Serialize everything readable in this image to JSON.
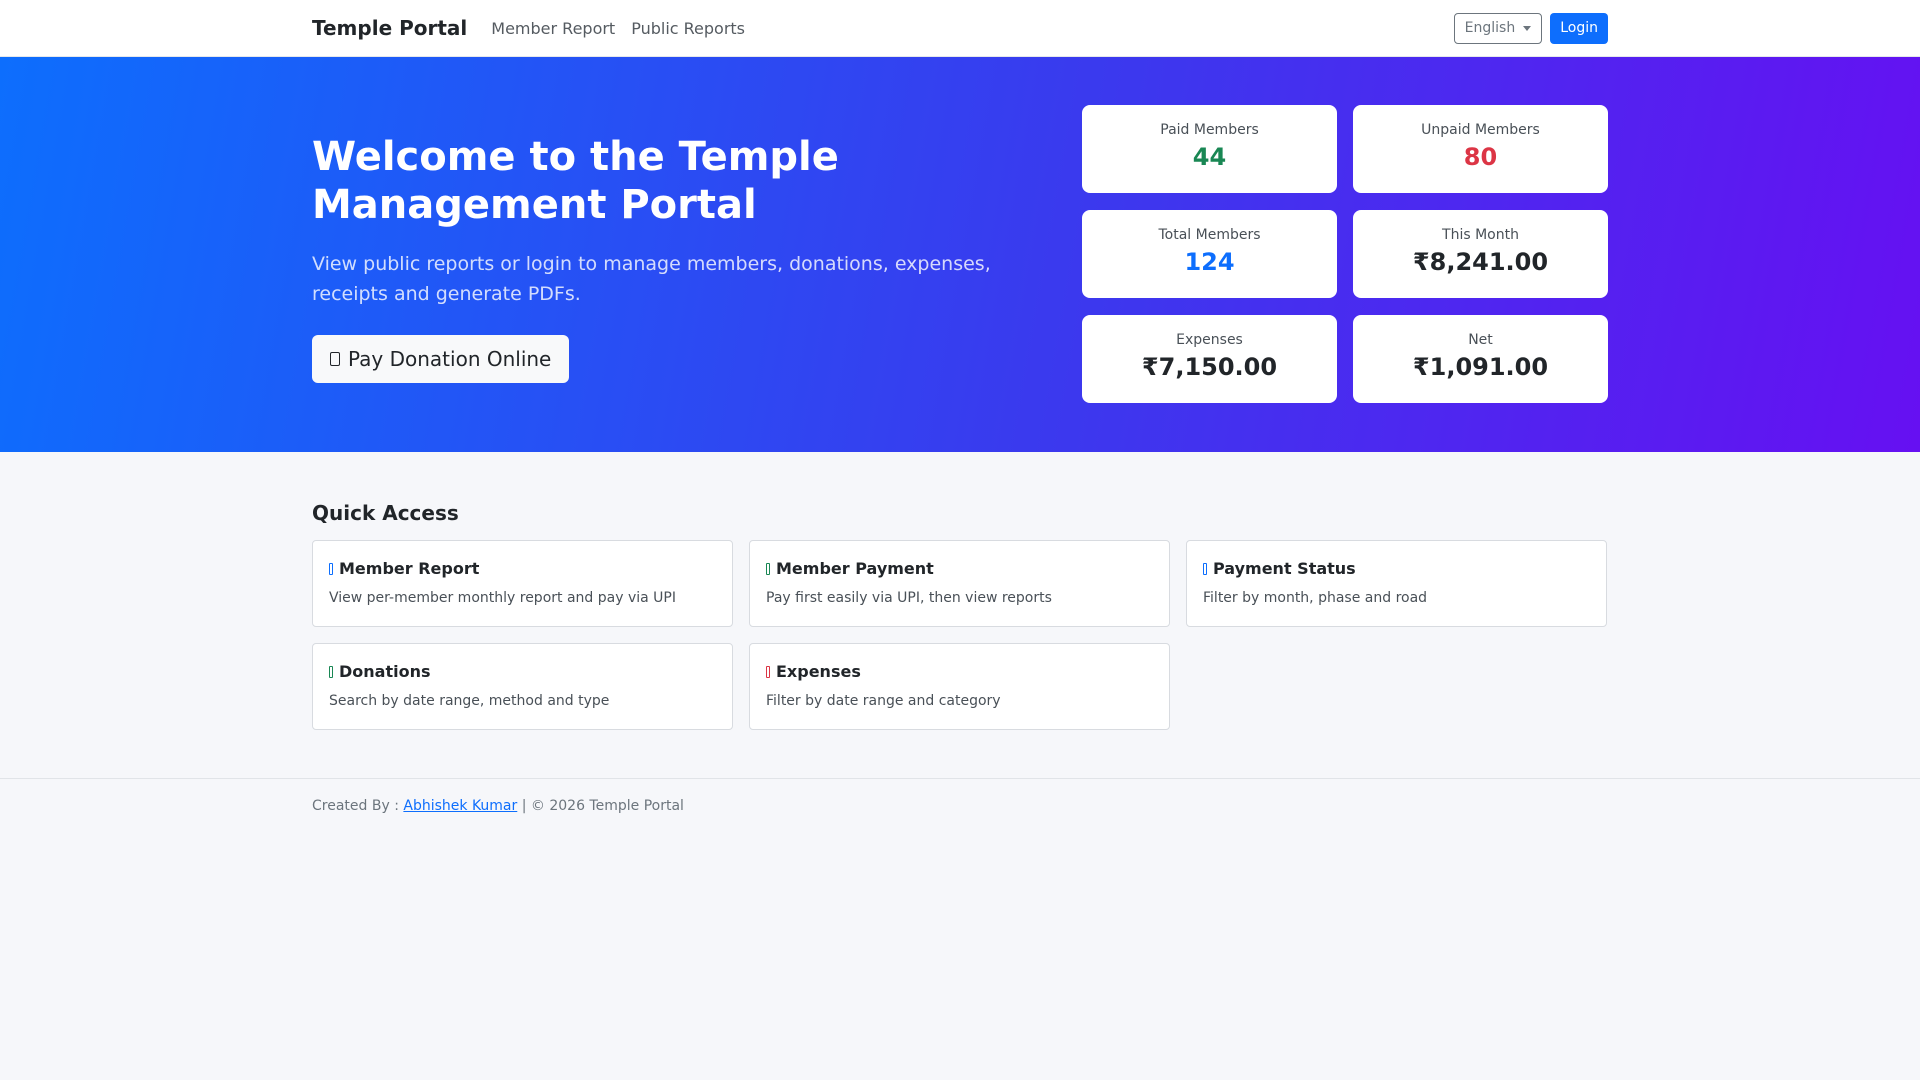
{
  "nav": {
    "brand": "Temple Portal",
    "links": [
      "Member Report",
      "Public Reports"
    ],
    "language": "English",
    "login": "Login"
  },
  "hero": {
    "title": "Welcome to the Temple Management Portal",
    "subtitle": "View public reports or login to manage members, donations, expenses, receipts and generate PDFs.",
    "donate_button": "Pay Donation Online",
    "stats": [
      {
        "label": "Paid Members",
        "value": "44",
        "color": "#198754"
      },
      {
        "label": "Unpaid Members",
        "value": "80",
        "color": "#dc3545"
      },
      {
        "label": "Total Members",
        "value": "124",
        "color": "#0d6efd"
      },
      {
        "label": "This Month",
        "value": "₹8,241.00",
        "color": "#212529"
      },
      {
        "label": "Expenses",
        "value": "₹7,150.00",
        "color": "#212529"
      },
      {
        "label": "Net",
        "value": "₹1,091.00",
        "color": "#212529"
      }
    ]
  },
  "quick_access": {
    "title": "Quick Access",
    "cards": [
      {
        "title": "Member Report",
        "desc": "View per-member monthly report and pay via UPI",
        "icon": "person-icon",
        "icon_color": "#0d6efd"
      },
      {
        "title": "Member Payment",
        "desc": "Pay first easily via UPI, then view reports",
        "icon": "wallet-icon",
        "icon_color": "#198754"
      },
      {
        "title": "Payment Status",
        "desc": "Filter by month, phase and road",
        "icon": "list-check-icon",
        "icon_color": "#0d6efd"
      },
      {
        "title": "Donations",
        "desc": "Search by date range, method and type",
        "icon": "cash-icon",
        "icon_color": "#198754"
      },
      {
        "title": "Expenses",
        "desc": "Filter by date range and category",
        "icon": "receipt-icon",
        "icon_color": "#dc3545"
      }
    ]
  },
  "footer": {
    "prefix": "Created By : ",
    "author": "Abhishek Kumar",
    "suffix": " | © 2026 Temple Portal"
  }
}
